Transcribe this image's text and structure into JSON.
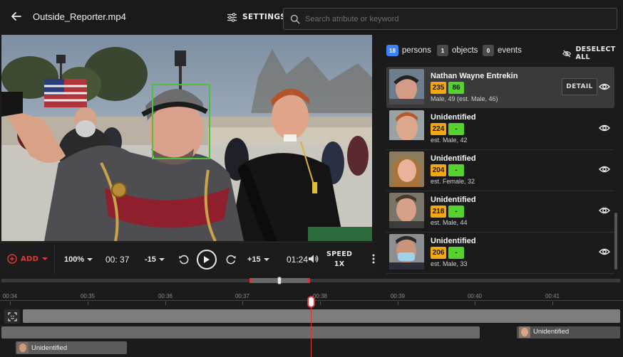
{
  "header": {
    "file_name": "Outside_Reporter.mp4",
    "settings_label": "SETTINGS",
    "search_placeholder": "Search atribute or keyword",
    "search_value": ""
  },
  "player": {
    "add_label": "ADD",
    "zoom": "100%",
    "current_time": "00: 37",
    "skip_back": "-15",
    "skip_forward": "+15",
    "end_time": "01:24",
    "speed_label": "SPEED",
    "speed_value": "1X"
  },
  "filters": {
    "persons": {
      "count": "18",
      "label": "persons"
    },
    "objects": {
      "count": "1",
      "label": "objects"
    },
    "events": {
      "count": "0",
      "label": "events"
    },
    "deselect_label": "DESELECT ALL"
  },
  "persons": [
    {
      "name": "Nathan Wayne Entrekin",
      "score1": "235",
      "score2": "86",
      "meta": "Male, 49 (est. Male, 46)",
      "selected": true,
      "detail_label": "DETAIL"
    },
    {
      "name": "Unidentified",
      "score1": "224",
      "score2": "-",
      "meta": "est. Male, 42"
    },
    {
      "name": "Unidentified",
      "score1": "204",
      "score2": "-",
      "meta": "est. Female, 32"
    },
    {
      "name": "Unidentified",
      "score1": "218",
      "score2": "-",
      "meta": "est. Male, 44"
    },
    {
      "name": "Unidentified",
      "score1": "206",
      "score2": "-",
      "meta": "est. Male, 33"
    }
  ],
  "timeline": {
    "ticks": [
      "00:34",
      "00:35",
      "00:36",
      "00:37",
      "00:38",
      "00:39",
      "00:40",
      "00:41"
    ],
    "track_label_a": "Unidentified",
    "track_label_b": "Unidentified"
  },
  "colors": {
    "accent_red": "#d8343a",
    "score_amber": "#f3a712",
    "score_green": "#56d12e",
    "persons_blue": "#3b82f6",
    "face_box": "#4cc23a"
  },
  "icons": [
    "back-arrow-icon",
    "settings-sliders-icon",
    "search-icon",
    "add-circle-icon",
    "chevron-down-icon",
    "rewind-icon",
    "play-icon",
    "fast-forward-icon",
    "volume-icon",
    "eye-off-icon",
    "eye-icon",
    "face-scan-icon"
  ]
}
